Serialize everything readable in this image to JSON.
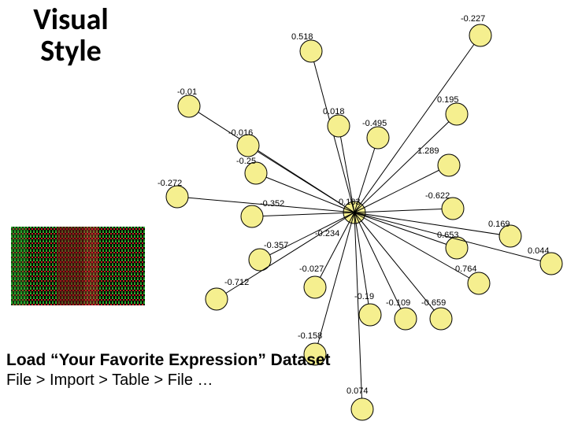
{
  "title_line1": "Visual",
  "title_line2": "Style",
  "footer": {
    "heading": "Load “Your Favorite Expression” Dataset",
    "path": "File > Import > Table > File …"
  },
  "network": {
    "hub_label": "0.183",
    "edges": [
      {
        "label": "0.518"
      },
      {
        "label": "-0.227"
      },
      {
        "label": "0.195"
      },
      {
        "label": "0.018"
      },
      {
        "label": "-0.495"
      },
      {
        "label": "1.289"
      },
      {
        "label": "-0.01"
      },
      {
        "label": "-0.016"
      },
      {
        "label": "-0.25"
      },
      {
        "label": "-0.272"
      },
      {
        "label": "-0.352"
      },
      {
        "label": "-0.622"
      },
      {
        "label": "0.169"
      },
      {
        "label": "0.653"
      },
      {
        "label": "-0.357"
      },
      {
        "label": "-0.234"
      },
      {
        "label": "0.044"
      },
      {
        "label": "0.764"
      },
      {
        "label": "-0.712"
      },
      {
        "label": "-0.027"
      },
      {
        "label": "-0.19"
      },
      {
        "label": "-0.109"
      },
      {
        "label": "-0.659"
      },
      {
        "label": "-0.158"
      },
      {
        "label": "0.074"
      }
    ]
  }
}
